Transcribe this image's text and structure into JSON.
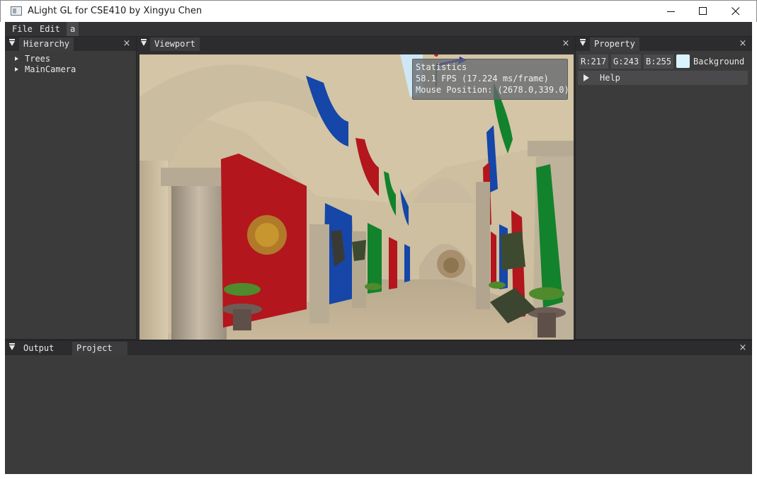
{
  "window": {
    "title": "ALight GL for CSE410 by Xingyu Chen",
    "controls": [
      "minimize",
      "maximize",
      "close"
    ]
  },
  "menu": {
    "items": [
      {
        "label": "File"
      },
      {
        "label": "Edit"
      },
      {
        "label": "a"
      }
    ]
  },
  "hierarchy": {
    "tab": "Hierarchy",
    "items": [
      {
        "label": "Trees"
      },
      {
        "label": "MainCamera"
      }
    ]
  },
  "viewport": {
    "tab": "Viewport",
    "stats": {
      "title": "Statistics",
      "fps": "58.1 FPS (17.224 ms/frame)",
      "mouse": "Mouse Position: (2678.0,339.0)"
    }
  },
  "property": {
    "tab": "Property",
    "r": "R:217",
    "g": "G:243",
    "b": "B:255",
    "background_label": "Background",
    "background_color": "#d9f3ff",
    "help_label": "Help"
  },
  "bottom": {
    "tabs": [
      {
        "label": "Output"
      },
      {
        "label": "Project"
      }
    ],
    "active_tab": "Project"
  },
  "icons": {
    "close": "×",
    "collapse": "collapse-arrow-icon"
  },
  "colors": {
    "panel_bg": "#3b3b3b",
    "header_bg": "#2c2c2e",
    "tab_bg": "#3d3d3f",
    "banner_red": "#b3161d",
    "banner_blue": "#1546a8",
    "banner_green": "#13822c"
  }
}
